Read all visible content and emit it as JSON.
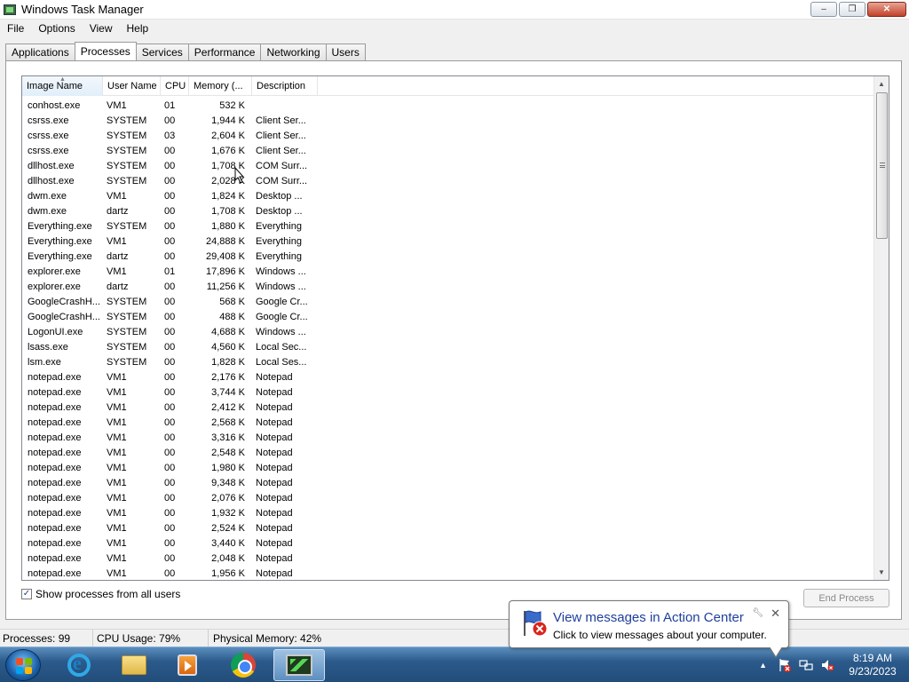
{
  "window": {
    "title": "Windows Task Manager",
    "buttons": {
      "minimize": "‒",
      "maximize": "❐",
      "close": "✕"
    }
  },
  "menu": [
    "File",
    "Options",
    "View",
    "Help"
  ],
  "tabs": [
    "Applications",
    "Processes",
    "Services",
    "Performance",
    "Networking",
    "Users"
  ],
  "active_tab": "Processes",
  "table": {
    "columns": [
      "Image Name",
      "User Name",
      "CPU",
      "Memory (...",
      "Description"
    ],
    "rows": [
      [
        "conhost.exe",
        "VM1",
        "01",
        "532 K",
        ""
      ],
      [
        "csrss.exe",
        "SYSTEM",
        "00",
        "1,944 K",
        "Client Ser..."
      ],
      [
        "csrss.exe",
        "SYSTEM",
        "03",
        "2,604 K",
        "Client Ser..."
      ],
      [
        "csrss.exe",
        "SYSTEM",
        "00",
        "1,676 K",
        "Client Ser..."
      ],
      [
        "dllhost.exe",
        "SYSTEM",
        "00",
        "1,708 K",
        "COM Surr..."
      ],
      [
        "dllhost.exe",
        "SYSTEM",
        "00",
        "2,028 K",
        "COM Surr..."
      ],
      [
        "dwm.exe",
        "VM1",
        "00",
        "1,824 K",
        "Desktop ..."
      ],
      [
        "dwm.exe",
        "dartz",
        "00",
        "1,708 K",
        "Desktop ..."
      ],
      [
        "Everything.exe",
        "SYSTEM",
        "00",
        "1,880 K",
        "Everything"
      ],
      [
        "Everything.exe",
        "VM1",
        "00",
        "24,888 K",
        "Everything"
      ],
      [
        "Everything.exe",
        "dartz",
        "00",
        "29,408 K",
        "Everything"
      ],
      [
        "explorer.exe",
        "VM1",
        "01",
        "17,896 K",
        "Windows ..."
      ],
      [
        "explorer.exe",
        "dartz",
        "00",
        "11,256 K",
        "Windows ..."
      ],
      [
        "GoogleCrashH...",
        "SYSTEM",
        "00",
        "568 K",
        "Google Cr..."
      ],
      [
        "GoogleCrashH...",
        "SYSTEM",
        "00",
        "488 K",
        "Google Cr..."
      ],
      [
        "LogonUI.exe",
        "SYSTEM",
        "00",
        "4,688 K",
        "Windows ..."
      ],
      [
        "lsass.exe",
        "SYSTEM",
        "00",
        "4,560 K",
        "Local Sec..."
      ],
      [
        "lsm.exe",
        "SYSTEM",
        "00",
        "1,828 K",
        "Local Ses..."
      ],
      [
        "notepad.exe",
        "VM1",
        "00",
        "2,176 K",
        "Notepad"
      ],
      [
        "notepad.exe",
        "VM1",
        "00",
        "3,744 K",
        "Notepad"
      ],
      [
        "notepad.exe",
        "VM1",
        "00",
        "2,412 K",
        "Notepad"
      ],
      [
        "notepad.exe",
        "VM1",
        "00",
        "2,568 K",
        "Notepad"
      ],
      [
        "notepad.exe",
        "VM1",
        "00",
        "3,316 K",
        "Notepad"
      ],
      [
        "notepad.exe",
        "VM1",
        "00",
        "2,548 K",
        "Notepad"
      ],
      [
        "notepad.exe",
        "VM1",
        "00",
        "1,980 K",
        "Notepad"
      ],
      [
        "notepad.exe",
        "VM1",
        "00",
        "9,348 K",
        "Notepad"
      ],
      [
        "notepad.exe",
        "VM1",
        "00",
        "2,076 K",
        "Notepad"
      ],
      [
        "notepad.exe",
        "VM1",
        "00",
        "1,932 K",
        "Notepad"
      ],
      [
        "notepad.exe",
        "VM1",
        "00",
        "2,524 K",
        "Notepad"
      ],
      [
        "notepad.exe",
        "VM1",
        "00",
        "3,440 K",
        "Notepad"
      ],
      [
        "notepad.exe",
        "VM1",
        "00",
        "2,048 K",
        "Notepad"
      ],
      [
        "notepad.exe",
        "VM1",
        "00",
        "1,956 K",
        "Notepad"
      ]
    ]
  },
  "show_all_label": "Show processes from all users",
  "show_all_checked": true,
  "end_process_label": "End Process",
  "status": {
    "processes": "Processes: 99",
    "cpu": "CPU Usage: 79%",
    "memory": "Physical Memory: 42%"
  },
  "balloon": {
    "title": "View messages in Action Center",
    "text": "Click to view messages about your computer."
  },
  "clock": {
    "time": "8:19 AM",
    "date": "9/23/2023"
  },
  "taskbar_apps": [
    "internet-explorer-icon",
    "windows-explorer-icon",
    "media-player-icon",
    "chrome-icon",
    "task-manager-icon"
  ],
  "colors": {
    "taskbar": "#2b5a8b",
    "balloon_title": "#1e3f9c",
    "close_button": "#c1412a"
  }
}
